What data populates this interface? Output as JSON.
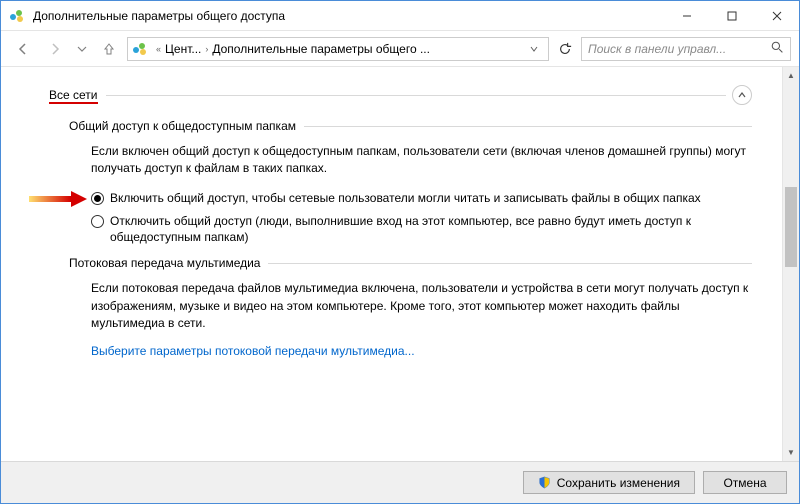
{
  "window": {
    "title": "Дополнительные параметры общего доступа"
  },
  "breadcrumb": {
    "item1": "Цент...",
    "item2": "Дополнительные параметры общего ..."
  },
  "search": {
    "placeholder": "Поиск в панели управл..."
  },
  "section": {
    "title": "Все сети"
  },
  "group1": {
    "title": "Общий доступ к общедоступным папкам",
    "desc": "Если включен общий доступ к общедоступным папкам, пользователи сети (включая членов домашней группы) могут получать доступ к файлам в таких папках.",
    "radio_on": "Включить общий доступ, чтобы сетевые пользователи могли читать и записывать файлы в общих папках",
    "radio_off": "Отключить общий доступ (люди, выполнившие вход на этот компьютер, все равно будут иметь доступ к общедоступным папкам)"
  },
  "group2": {
    "title": "Потоковая передача мультимедиа",
    "desc": "Если потоковая передача файлов мультимедиа включена, пользователи и устройства в сети могут получать доступ к изображениям, музыке и видео на этом компьютере. Кроме того, этот компьютер может находить файлы мультимедиа в сети.",
    "link": "Выберите параметры потоковой передачи мультимедиа..."
  },
  "buttons": {
    "save": "Сохранить изменения",
    "cancel": "Отмена"
  }
}
